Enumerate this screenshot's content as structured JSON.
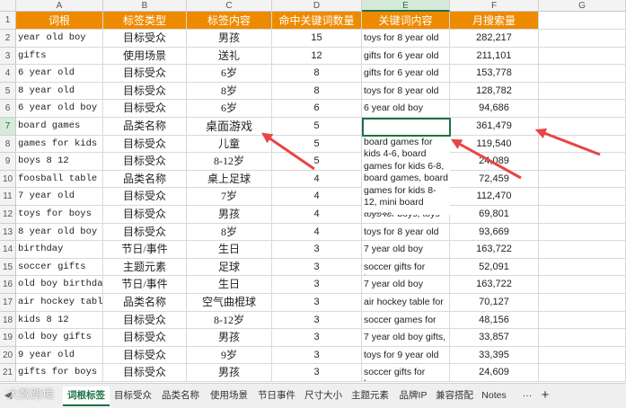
{
  "columns": [
    "A",
    "B",
    "C",
    "D",
    "E",
    "F",
    "G"
  ],
  "header": [
    "词根",
    "标签类型",
    "标签内容",
    "命中关键词数量",
    "关键词内容",
    "月搜索量"
  ],
  "rows": [
    {
      "n": "2",
      "a": "year old boy",
      "b": "目标受众",
      "c": "男孩",
      "d": "15",
      "e": "toys for 8 year old",
      "f": "282,217"
    },
    {
      "n": "3",
      "a": "gifts",
      "b": "使用场景",
      "c": "送礼",
      "d": "12",
      "e": "gifts for 6 year old",
      "f": "211,101"
    },
    {
      "n": "4",
      "a": "6 year old",
      "b": "目标受众",
      "c": "6岁",
      "d": "8",
      "e": "gifts for 6 year old",
      "f": "153,778"
    },
    {
      "n": "5",
      "a": "8 year old",
      "b": "目标受众",
      "c": "8岁",
      "d": "8",
      "e": "toys for 8 year old",
      "f": "128,782"
    },
    {
      "n": "6",
      "a": "6 year old boy",
      "b": "目标受众",
      "c": "6岁",
      "d": "6",
      "e": "6 year old boy",
      "f": "94,686"
    },
    {
      "n": "7",
      "a": "board games",
      "b": "品类名称",
      "c": "桌面游戏",
      "d": "5",
      "e": "board games for kids 4-6, board games for kids 6-8, board games, board games for kids 8-12, mini board games",
      "f": "361,479"
    },
    {
      "n": "8",
      "a": "games for kids",
      "b": "目标受众",
      "c": "儿童",
      "d": "5",
      "e": "",
      "f": "119,540"
    },
    {
      "n": "9",
      "a": "boys 8 12",
      "b": "目标受众",
      "c": "8-12岁",
      "d": "5",
      "e": "",
      "f": "24,089"
    },
    {
      "n": "10",
      "a": "foosball table",
      "b": "品类名称",
      "c": "桌上足球",
      "d": "4",
      "e": "",
      "f": "72,459"
    },
    {
      "n": "11",
      "a": "7 year old",
      "b": "目标受众",
      "c": "7岁",
      "d": "4",
      "e": "",
      "f": "112,470"
    },
    {
      "n": "12",
      "a": "toys for boys",
      "b": "目标受众",
      "c": "男孩",
      "d": "4",
      "e": "toys for boys, toys",
      "f": "69,801"
    },
    {
      "n": "13",
      "a": "8 year old boy",
      "b": "目标受众",
      "c": "8岁",
      "d": "4",
      "e": "toys for 8 year old",
      "f": "93,669"
    },
    {
      "n": "14",
      "a": "birthday",
      "b": "节日/事件",
      "c": "生日",
      "d": "3",
      "e": "7 year old boy",
      "f": "163,722"
    },
    {
      "n": "15",
      "a": "soccer gifts",
      "b": "主题元素",
      "c": "足球",
      "d": "3",
      "e": "soccer gifts for boys",
      "f": "52,091"
    },
    {
      "n": "16",
      "a": "old boy birthday",
      "b": "节日/事件",
      "c": "生日",
      "d": "3",
      "e": "7 year old boy",
      "f": "163,722"
    },
    {
      "n": "17",
      "a": "air hockey table",
      "b": "品类名称",
      "c": "空气曲棍球",
      "d": "3",
      "e": "air hockey table for",
      "f": "70,127"
    },
    {
      "n": "18",
      "a": "kids 8 12",
      "b": "目标受众",
      "c": "8-12岁",
      "d": "3",
      "e": "soccer games for",
      "f": "48,156"
    },
    {
      "n": "19",
      "a": "old boy gifts",
      "b": "目标受众",
      "c": "男孩",
      "d": "3",
      "e": "7 year old boy gifts,",
      "f": "33,857"
    },
    {
      "n": "20",
      "a": "9 year old",
      "b": "目标受众",
      "c": "9岁",
      "d": "3",
      "e": "toys for 9 year old",
      "f": "33,395"
    },
    {
      "n": "21",
      "a": "gifts for boys",
      "b": "目标受众",
      "c": "男孩",
      "d": "3",
      "e": "soccer gifts for boys",
      "f": "24,609"
    }
  ],
  "sheet_tabs": [
    "词根标签",
    "目标受众",
    "品类名称",
    "使用场景",
    "节日事件",
    "尺寸大小",
    "主题元素",
    "品牌IP",
    "兼容搭配",
    "Notes"
  ],
  "tab_more": "···",
  "tab_add": "+",
  "watermark": "大数跨境",
  "colors": {
    "header_bg": "#ee8a00",
    "accent": "#1e7145",
    "arrow": "#e84545"
  }
}
